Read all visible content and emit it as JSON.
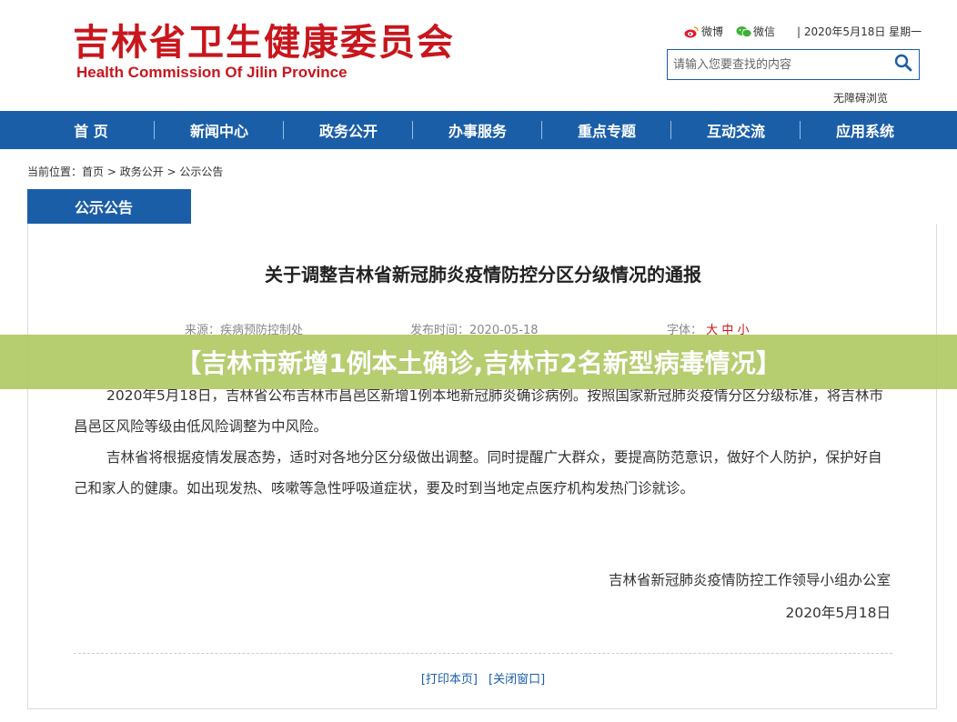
{
  "header": {
    "title_cn": "吉林省卫生健康委员会",
    "title_en": "Health Commission Of Jilin Province",
    "weibo_label": "微博",
    "weixin_label": "微信",
    "date_text": "| 2020年5月18日 星期一",
    "search_placeholder": "请输入您要查找的内容",
    "accessible_label": "无障碍浏览",
    "brand_red": "#c8161d",
    "brand_blue": "#1b5ea8"
  },
  "nav": {
    "items": [
      "首 页",
      "新闻中心",
      "政务公开",
      "办事服务",
      "重点专题",
      "互动交流",
      "应用系统"
    ]
  },
  "breadcrumb": {
    "prefix": "当前位置：",
    "items": [
      "首页",
      "政务公开",
      "公示公告"
    ],
    "separator": " > "
  },
  "section": {
    "tab_label": "公示公告"
  },
  "article": {
    "title": "关于调整吉林省新冠肺炎疫情防控分区分级情况的通报",
    "source_label": "来源：",
    "source_value": "疾病预防控制处",
    "date_label": "发布时间：",
    "date_value": "2020-05-18",
    "font_label": "字体：",
    "font_options": [
      "大",
      "中",
      "小"
    ],
    "paragraphs": [
      "2020年5月18日，吉林省公布吉林市昌邑区新增1例本地新冠肺炎确诊病例。按照国家新冠肺炎疫情分区分级标准，将吉林市昌邑区风险等级由低风险调整为中风险。",
      "吉林省将根据疫情发展态势，适时对各地分区分级做出调整。同时提醒广大群众，要提高防范意识，做好个人防护，保护好自己和家人的健康。如出现发热、咳嗽等急性呼吸道症状，要及时到当地定点医疗机构发热门诊就诊。"
    ],
    "signature_org": "吉林省新冠肺炎疫情防控工作领导小组办公室",
    "signature_date": "2020年5月18日",
    "print_label": "[打印本页]",
    "close_label": "[关闭窗口]"
  },
  "banner": {
    "text": "【吉林市新增1例本土确诊,吉林市2名新型病毒情况】",
    "color": "#aec860"
  }
}
